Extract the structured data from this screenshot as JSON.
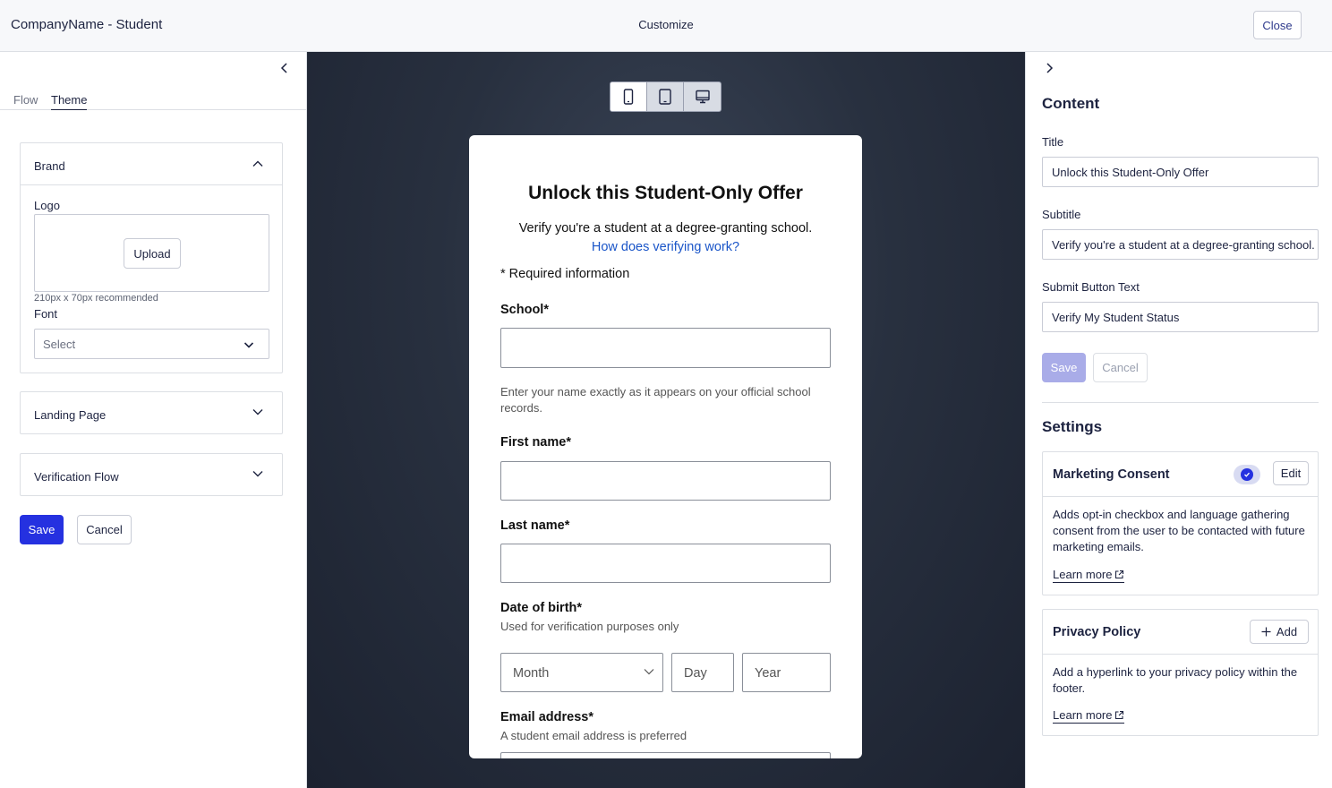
{
  "header": {
    "app_title": "CompanyName - Student",
    "center_label": "Customize",
    "close_label": "Close"
  },
  "left": {
    "tabs": [
      {
        "label": "Flow",
        "active": false
      },
      {
        "label": "Theme",
        "active": true
      }
    ],
    "brand": {
      "title": "Brand",
      "logo_label": "Logo",
      "upload_label": "Upload",
      "logo_hint": "210px x 70px recommended",
      "font_label": "Font",
      "font_select_placeholder": "Select"
    },
    "landing_page_title": "Landing Page",
    "verification_flow_title": "Verification Flow",
    "save_label": "Save",
    "cancel_label": "Cancel"
  },
  "preview": {
    "device_options": [
      "mobile-icon",
      "tablet-icon",
      "desktop-icon"
    ],
    "active_device": "mobile",
    "form": {
      "title": "Unlock this Student-Only Offer",
      "subtitle": "Verify you're a student at a degree-granting school.",
      "help_link": "How does verifying work?",
      "required_note": "* Required information",
      "school_label": "School*",
      "school_hint": "Enter your name exactly as it appears on your official school records.",
      "first_name_label": "First name*",
      "last_name_label": "Last name*",
      "dob_label": "Date of birth*",
      "dob_hint": "Used for verification purposes only",
      "month_placeholder": "Month",
      "day_placeholder": "Day",
      "year_placeholder": "Year",
      "email_label": "Email address*",
      "email_hint": "A student email address is preferred"
    }
  },
  "right": {
    "content_heading": "Content",
    "title_label": "Title",
    "title_value": "Unlock this Student-Only Offer",
    "subtitle_label": "Subtitle",
    "subtitle_value": "Verify you're a student at a degree-granting school.",
    "submit_label": "Submit Button Text",
    "submit_value": "Verify My Student Status",
    "save_label": "Save",
    "cancel_label": "Cancel",
    "settings_heading": "Settings",
    "marketing": {
      "title": "Marketing Consent",
      "enabled": true,
      "edit_label": "Edit",
      "description": "Adds opt-in checkbox and language gathering consent from the user to be contacted with future marketing emails.",
      "learn_more": "Learn more"
    },
    "privacy": {
      "title": "Privacy Policy",
      "add_label": "Add",
      "description": "Add a hyperlink to your privacy policy within the footer.",
      "learn_more": "Learn more"
    }
  },
  "colors": {
    "primary": "#2531e0",
    "primary_disabled": "#a9ace8",
    "link": "#1a55c8",
    "preview_bg": "#28303f"
  }
}
